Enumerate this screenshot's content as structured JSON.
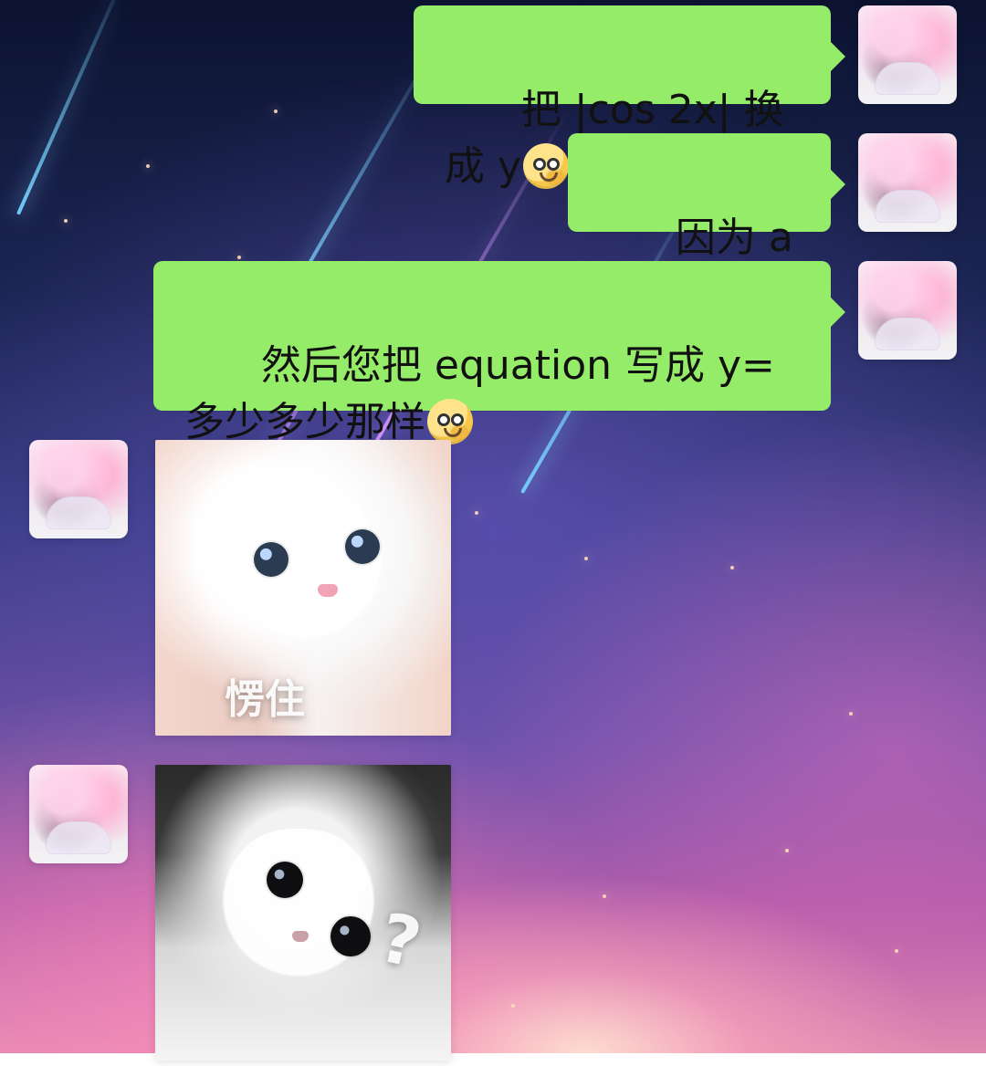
{
  "messages": [
    {
      "side": "right",
      "text": "把 |cos 2x| 换成 y",
      "emoji": "thinking-face-emoji"
    },
    {
      "side": "right",
      "text": "因为 a 有讲"
    },
    {
      "side": "right",
      "text": "然后您把 equation 写成 y=多少多少那样",
      "emoji": "thinking-face-emoji"
    },
    {
      "side": "left",
      "sticker": {
        "caption": "愣住",
        "icon": "cat-sticker"
      }
    },
    {
      "side": "left",
      "sticker": {
        "caption": "?",
        "icon": "cat-sticker"
      }
    }
  ],
  "colors": {
    "bubble_green": "#95ec69"
  }
}
